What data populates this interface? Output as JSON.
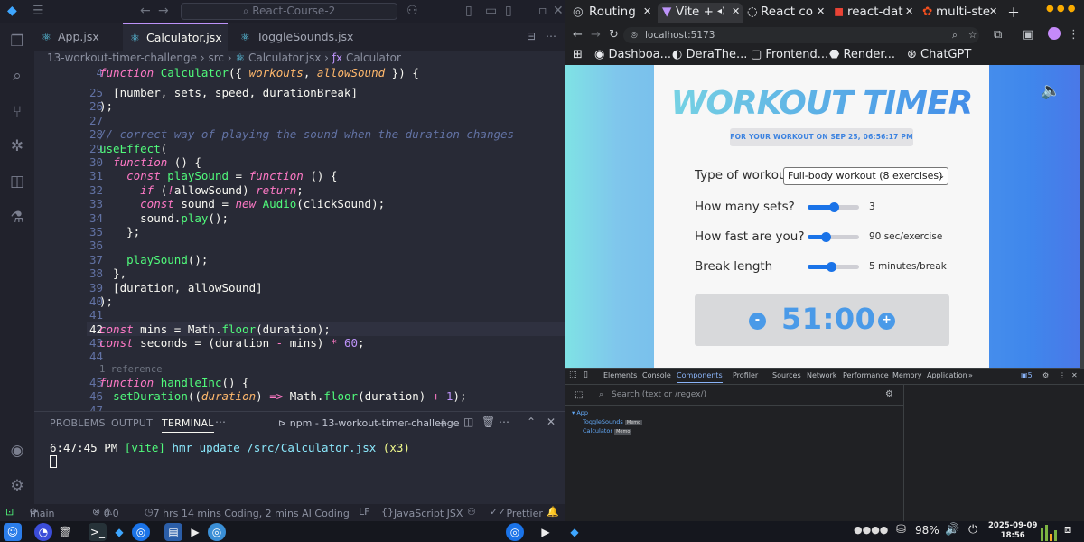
{
  "vscode": {
    "search": "React-Course-2",
    "tabs": [
      "App.jsx",
      "Calculator.jsx",
      "ToggleSounds.jsx"
    ],
    "breadcrumb": {
      "folder": "13-workout-timer-challenge",
      "src": "src",
      "file": "Calculator.jsx",
      "symbol": "Calculator"
    },
    "line_numbers": [
      "4",
      "25",
      "26",
      "27",
      "28",
      "29",
      "30",
      "31",
      "32",
      "33",
      "34",
      "35",
      "36",
      "37",
      "38",
      "39",
      "40",
      "41",
      "42",
      "43",
      "44",
      "",
      "45",
      "46",
      "47"
    ],
    "references": "1 reference",
    "panel_tabs": [
      "PROBLEMS",
      "OUTPUT",
      "TERMINAL"
    ],
    "terminal_name": "npm - 13-workout-timer-challenge",
    "terminal_time": "6:47:45 PM",
    "terminal_tag": "[vite]",
    "terminal_msg": "hmr update /src/Calculator.jsx",
    "terminal_count": "(x3)",
    "status": {
      "branch": "main",
      "errors": "0",
      "warnings": "0",
      "coding": "7 hrs 14 mins Coding, 2 mins AI Coding",
      "eol": "LF",
      "lang": "JavaScript JSX",
      "prettier": "Prettier"
    }
  },
  "browser": {
    "tabs": [
      "Routing",
      "Vite +",
      "React co",
      "react-dat",
      "multi-ste"
    ],
    "url": "localhost:5173",
    "bookmarks": [
      "Dashboa...",
      "DeraThe...",
      "Frontend...",
      "Render...",
      "ChatGPT"
    ],
    "app": {
      "title": "WORKOUT TIMER",
      "date": "FOR YOUR WORKOUT ON SEP 25, 06:56:17 PM",
      "workout_label": "Type of workout",
      "workout_value": "Full-body workout (8 exercises)",
      "sets_label": "How many sets?",
      "sets_value": "3",
      "sets_level": 0.5,
      "speed_label": "How fast are you?",
      "speed_value": "90 sec/exercise",
      "speed_level": 0.35,
      "break_label": "Break length",
      "break_value": "5 minutes/break",
      "break_level": 0.45,
      "timer": "51:00",
      "minus": "-",
      "plus": "+"
    },
    "devtools": {
      "tabs": [
        "Elements",
        "Console",
        "Components",
        "Profiler",
        "Sources",
        "Network",
        "Performance",
        "Memory",
        "Application"
      ],
      "issues": "5",
      "search_placeholder": "Search (text or /regex/)",
      "tree_root": "App",
      "tree_children": [
        "ToggleSounds",
        "Calculator"
      ],
      "memo": "Memo"
    }
  },
  "taskbar": {
    "battery": "98%",
    "date": "2025-09-09",
    "time": "18:56"
  },
  "colors": {
    "accent": "#bd93f9",
    "chrome_blue": "#1a73e8",
    "timer_blue": "#4a9ae8"
  }
}
